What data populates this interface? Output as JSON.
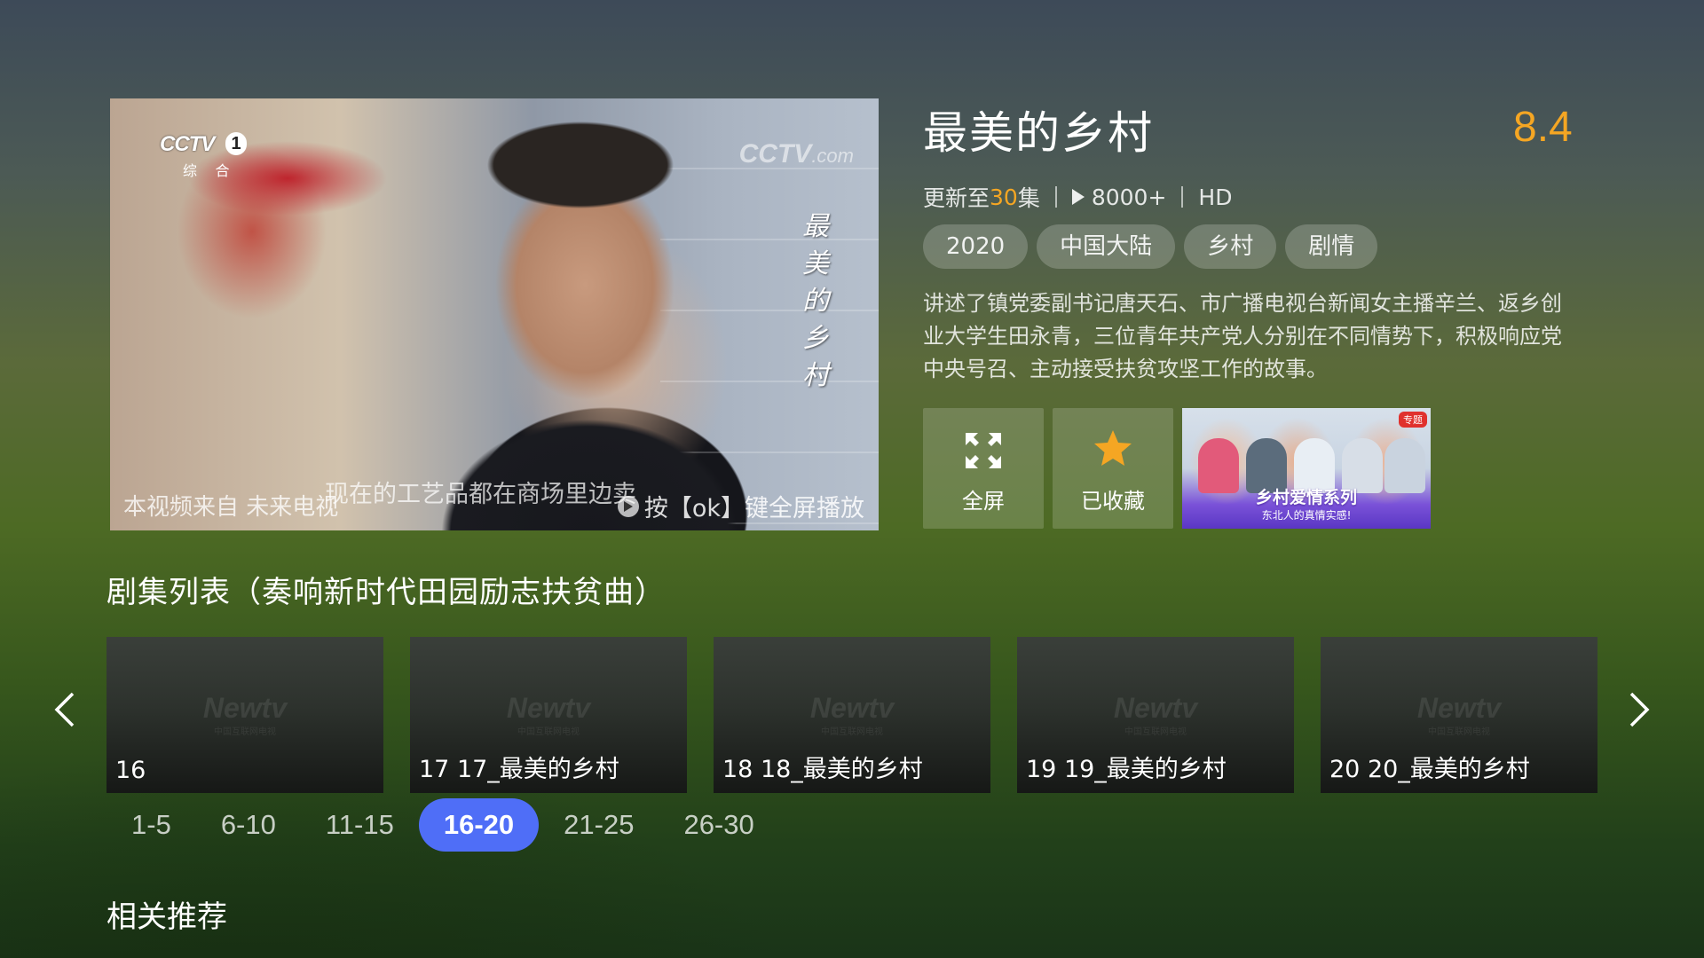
{
  "player": {
    "channel_logo": "CCTV",
    "channel_number": "1",
    "channel_sub": "综 合",
    "watermark": "CCTV",
    "watermark_suffix": ".com",
    "video_title": "最美的乡村",
    "subtitle": "现在的工艺品都在商场里边卖",
    "source_text": "本视频来自 未来电视",
    "hint_text": "按【ok】键全屏播放"
  },
  "show": {
    "title": "最美的乡村",
    "rating": "8.4",
    "update_prefix": "更新至",
    "update_count": "30",
    "update_suffix": "集",
    "play_count": "8000+",
    "quality": "HD",
    "tags": [
      "2020",
      "中国大陆",
      "乡村",
      "剧情"
    ],
    "description": "讲述了镇党委副书记唐天石、市广播电视台新闻女主播辛兰、返乡创业大学生田永青，三位青年共产党人分别在不同情势下，积极响应党中央号召、主动接受扶贫攻坚工作的故事。"
  },
  "actions": {
    "fullscreen_label": "全屏",
    "favorite_label": "已收藏"
  },
  "promo": {
    "badge": "专题",
    "title": "乡村爱情系列",
    "subtitle": "东北人的真情实感!"
  },
  "episodes": {
    "heading": "剧集列表（奏响新时代田园励志扶贫曲）",
    "watermark": "Newtv",
    "watermark_sub": "中国互联网电视",
    "items": [
      {
        "label": "16"
      },
      {
        "label": "17 17_最美的乡村"
      },
      {
        "label": "18 18_最美的乡村"
      },
      {
        "label": "19 19_最美的乡村"
      },
      {
        "label": "20 20_最美的乡村"
      }
    ],
    "ranges": [
      "1-5",
      "6-10",
      "11-15",
      "16-20",
      "21-25",
      "26-30"
    ],
    "active_range": "16-20"
  },
  "related": {
    "heading": "相关推荐"
  },
  "colors": {
    "accent": "#f5a623",
    "active_tab": "#4f6ef7"
  }
}
